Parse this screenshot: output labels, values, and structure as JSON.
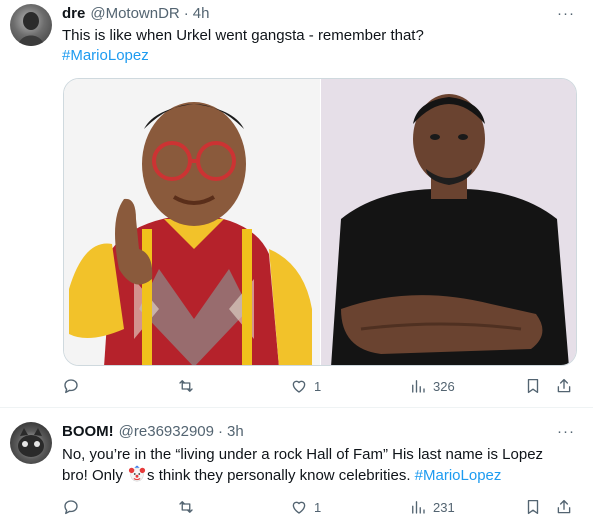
{
  "tweets": [
    {
      "author": {
        "name": "dre",
        "handle": "@MotownDR",
        "time": "4h"
      },
      "text_line1": "This is like when Urkel went gangsta - remember that?",
      "hashtag": "#MarioLopez",
      "stats": {
        "replies": "",
        "retweets": "",
        "likes": "1",
        "views": "326"
      }
    },
    {
      "author": {
        "name": "BOOM!",
        "handle": "@re36932909",
        "time": "3h"
      },
      "text_line1": "No, you’re in the “living under a rock Hall of Fam”  His last name is Lopez",
      "text_line2_before": "bro! Only ",
      "text_line2_after": "s think they personally know celebrities. ",
      "hashtag": "#MarioLopez",
      "stats": {
        "replies": "",
        "retweets": "",
        "likes": "1",
        "views": "231"
      }
    }
  ],
  "ui": {
    "separator": "·",
    "more": "···"
  },
  "icons": [
    "reply-icon",
    "retweet-icon",
    "like-icon",
    "views-icon",
    "bookmark-icon",
    "share-icon",
    "more-icon",
    "clown-emoji"
  ],
  "colors": {
    "link": "#1d9bf0",
    "secondary": "#536471",
    "text": "#0f1419",
    "border": "#cfd9de"
  }
}
